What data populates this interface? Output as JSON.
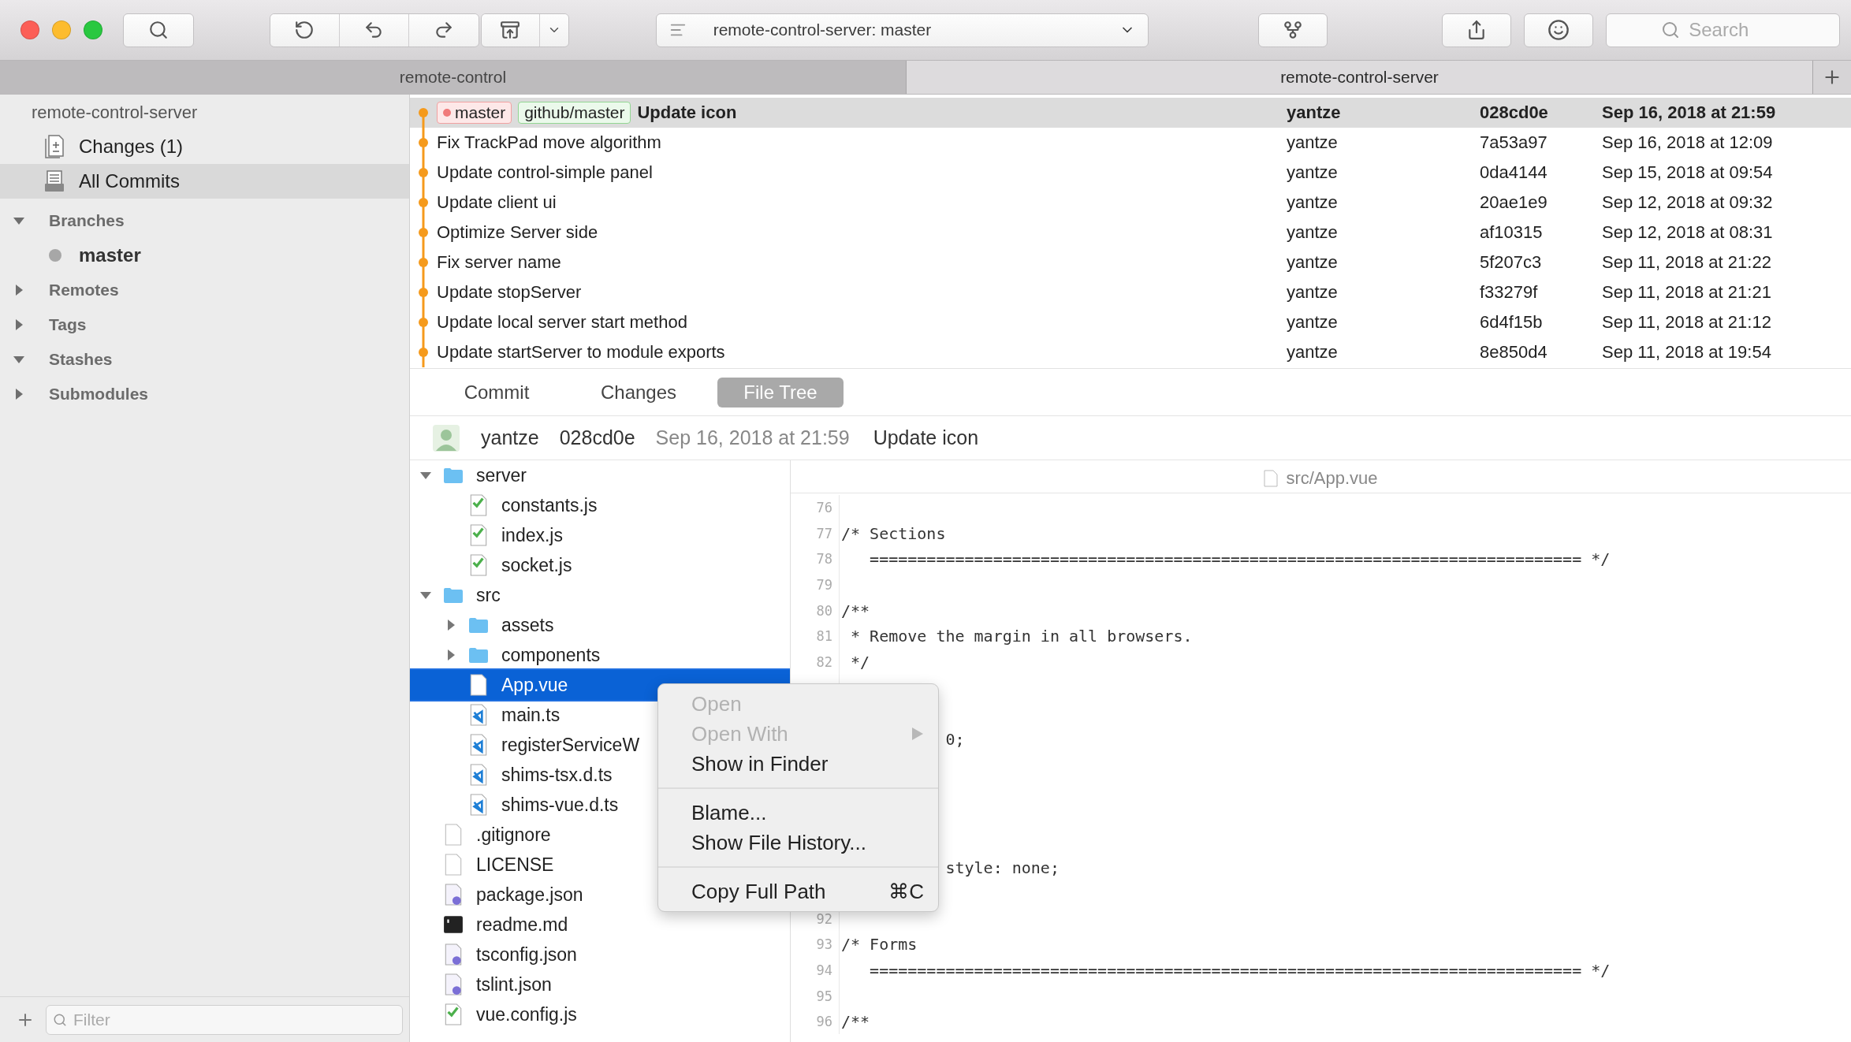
{
  "toolbar": {
    "repository": "remote-control-server: master",
    "search": {
      "placeholder": "Search"
    }
  },
  "window_tabs": [
    {
      "label": "remote-control",
      "selected": false
    },
    {
      "label": "remote-control-server",
      "selected": true
    }
  ],
  "sidebar": {
    "repository": "remote-control-server",
    "items": [
      {
        "label": "Changes (1)",
        "kind": "changes",
        "selected": false
      },
      {
        "label": "All Commits",
        "kind": "commits",
        "selected": true
      }
    ],
    "sections": [
      {
        "label": "Branches",
        "expanded": true,
        "children": [
          {
            "label": "master"
          }
        ]
      },
      {
        "label": "Remotes",
        "expanded": false
      },
      {
        "label": "Tags",
        "expanded": false
      },
      {
        "label": "Stashes",
        "expanded": true
      },
      {
        "label": "Submodules",
        "expanded": false
      }
    ],
    "filter": {
      "placeholder": "Filter"
    }
  },
  "commits": [
    {
      "subject": "Update icon",
      "author": "yantze",
      "hash": "028cd0e",
      "date": "Sep 16, 2018 at 21:59",
      "selected": true,
      "refs": [
        {
          "label": "master",
          "kind": "local"
        },
        {
          "label": "github/master",
          "kind": "remote"
        }
      ]
    },
    {
      "subject": "Fix TrackPad move algorithm",
      "author": "yantze",
      "hash": "7a53a97",
      "date": "Sep 16, 2018 at 12:09",
      "selected": false
    },
    {
      "subject": "Update control-simple panel",
      "author": "yantze",
      "hash": "0da4144",
      "date": "Sep 15, 2018 at 09:54",
      "selected": false
    },
    {
      "subject": "Update client ui",
      "author": "yantze",
      "hash": "20ae1e9",
      "date": "Sep 12, 2018 at 09:32",
      "selected": false
    },
    {
      "subject": "Optimize Server side",
      "author": "yantze",
      "hash": "af10315",
      "date": "Sep 12, 2018 at 08:31",
      "selected": false
    },
    {
      "subject": "Fix server name",
      "author": "yantze",
      "hash": "5f207c3",
      "date": "Sep 11, 2018 at 21:22",
      "selected": false
    },
    {
      "subject": "Update stopServer",
      "author": "yantze",
      "hash": "f33279f",
      "date": "Sep 11, 2018 at 21:21",
      "selected": false
    },
    {
      "subject": "Update local server start method",
      "author": "yantze",
      "hash": "6d4f15b",
      "date": "Sep 11, 2018 at 21:12",
      "selected": false
    },
    {
      "subject": "Update startServer to module exports",
      "author": "yantze",
      "hash": "8e850d4",
      "date": "Sep 11, 2018 at 19:54",
      "selected": false
    }
  ],
  "detail_tabs": [
    {
      "label": "Commit",
      "selected": false
    },
    {
      "label": "Changes",
      "selected": false
    },
    {
      "label": "File Tree",
      "selected": true
    }
  ],
  "commit_info": {
    "author": "yantze",
    "hash": "028cd0e",
    "date": "Sep 16, 2018 at 21:59",
    "subject": "Update icon"
  },
  "file_tree": [
    {
      "name": "server",
      "kind": "folder",
      "expanded": true,
      "selected": false,
      "children": [
        {
          "name": "constants.js",
          "kind": "js",
          "selected": false
        },
        {
          "name": "index.js",
          "kind": "js",
          "selected": false
        },
        {
          "name": "socket.js",
          "kind": "js",
          "selected": false
        }
      ]
    },
    {
      "name": "src",
      "kind": "folder",
      "expanded": true,
      "selected": false,
      "children": [
        {
          "name": "assets",
          "kind": "folder",
          "expanded": false,
          "selected": false
        },
        {
          "name": "components",
          "kind": "folder",
          "expanded": false,
          "selected": false
        },
        {
          "name": "App.vue",
          "kind": "plain",
          "selected": true
        },
        {
          "name": "main.ts",
          "kind": "ts",
          "selected": false
        },
        {
          "name": "registerServiceW",
          "kind": "ts",
          "selected": false
        },
        {
          "name": "shims-tsx.d.ts",
          "kind": "ts",
          "selected": false
        },
        {
          "name": "shims-vue.d.ts",
          "kind": "ts",
          "selected": false
        }
      ]
    },
    {
      "name": ".gitignore",
      "kind": "plain",
      "selected": false
    },
    {
      "name": "LICENSE",
      "kind": "plain",
      "selected": false
    },
    {
      "name": "package.json",
      "kind": "json",
      "selected": false
    },
    {
      "name": "readme.md",
      "kind": "terminal",
      "selected": false
    },
    {
      "name": "tsconfig.json",
      "kind": "json",
      "selected": false
    },
    {
      "name": "tslint.json",
      "kind": "json",
      "selected": false
    },
    {
      "name": "vue.config.js",
      "kind": "js",
      "selected": false
    }
  ],
  "file_view": {
    "path": "src/App.vue",
    "lines": [
      {
        "kind": "line",
        "number": "76"
      },
      {
        "kind": "line",
        "number": "77",
        "text": "/* Sections"
      },
      {
        "kind": "line",
        "number": "78",
        "text": "   =========================================================================== */"
      },
      {
        "kind": "line",
        "number": "79"
      },
      {
        "kind": "line",
        "number": "80",
        "text": "/**"
      },
      {
        "kind": "line",
        "number": "81",
        "text": " * Remove the margin in all browsers."
      },
      {
        "kind": "line",
        "number": "82",
        "text": " */"
      },
      {
        "kind": "covered"
      },
      {
        "kind": "covered"
      },
      {
        "kind": "covered",
        "text": "0;"
      },
      {
        "kind": "covered"
      },
      {
        "kind": "covered"
      },
      {
        "kind": "covered"
      },
      {
        "kind": "covered"
      },
      {
        "kind": "covered",
        "text": "style: none;"
      },
      {
        "kind": "covered"
      },
      {
        "kind": "line",
        "number": "92"
      },
      {
        "kind": "line",
        "number": "93",
        "text": "/* Forms"
      },
      {
        "kind": "line",
        "number": "94",
        "text": "   =========================================================================== */"
      },
      {
        "kind": "line",
        "number": "95"
      },
      {
        "kind": "line",
        "number": "96",
        "text": "/**"
      }
    ]
  },
  "context_menu": [
    {
      "kind": "item",
      "label": "Open",
      "disabled": true
    },
    {
      "kind": "submenu",
      "label": "Open With",
      "disabled": true
    },
    {
      "kind": "item",
      "label": "Show in Finder",
      "disabled": false
    },
    {
      "kind": "separator"
    },
    {
      "kind": "item",
      "label": "Blame...",
      "disabled": false
    },
    {
      "kind": "item",
      "label": "Show File History...",
      "disabled": false
    },
    {
      "kind": "separator"
    },
    {
      "kind": "item",
      "label": "Copy Full Path",
      "shortcut": "⌘C",
      "disabled": false
    }
  ]
}
